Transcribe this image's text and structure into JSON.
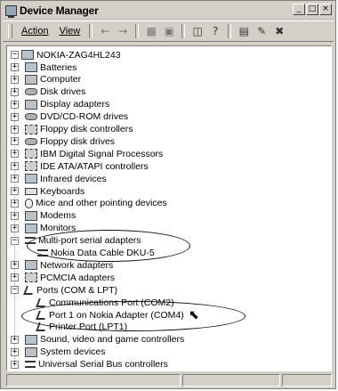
{
  "window": {
    "title": "Device Manager",
    "buttons": {
      "minimize": "_",
      "maximize": "□",
      "close": "×"
    }
  },
  "menubar": {
    "action": "Action",
    "view": "View"
  },
  "toolbar": {
    "back": "←",
    "forward": "→",
    "up": "▦",
    "tree": "▣",
    "properties": "◫",
    "help": "?",
    "scan": "▤",
    "uninstall": "✎",
    "disable": "✖"
  },
  "tree": {
    "root": "NOKIA-ZAG4HL243",
    "nodes": [
      {
        "label": "Batteries",
        "expander": "+",
        "icon": "battery-icon"
      },
      {
        "label": "Computer",
        "expander": "+",
        "icon": "computer-icon"
      },
      {
        "label": "Disk drives",
        "expander": "+",
        "icon": "disk-icon"
      },
      {
        "label": "Display adapters",
        "expander": "+",
        "icon": "display-icon"
      },
      {
        "label": "DVD/CD-ROM drives",
        "expander": "+",
        "icon": "cdrom-icon"
      },
      {
        "label": "Floppy disk controllers",
        "expander": "+",
        "icon": "floppy-controller-icon"
      },
      {
        "label": "Floppy disk drives",
        "expander": "+",
        "icon": "floppy-drive-icon"
      },
      {
        "label": "IBM Digital Signal Processors",
        "expander": "+",
        "icon": "dsp-icon"
      },
      {
        "label": "IDE ATA/ATAPI controllers",
        "expander": "+",
        "icon": "ide-icon"
      },
      {
        "label": "Infrared devices",
        "expander": "+",
        "icon": "infrared-icon"
      },
      {
        "label": "Keyboards",
        "expander": "+",
        "icon": "keyboard-icon"
      },
      {
        "label": "Mice and other pointing devices",
        "expander": "+",
        "icon": "mouse-icon"
      },
      {
        "label": "Modems",
        "expander": "+",
        "icon": "modem-icon"
      },
      {
        "label": "Monitors",
        "expander": "+",
        "icon": "monitor-icon"
      },
      {
        "label": "Multi-port serial adapters",
        "expander": "−",
        "icon": "serial-icon"
      },
      {
        "label": "Nokia Data Cable DKU-5",
        "child": true,
        "icon": "cable-icon"
      },
      {
        "label": "Network adapters",
        "expander": "+",
        "icon": "network-icon"
      },
      {
        "label": "PCMCIA adapters",
        "expander": "+",
        "icon": "pcmcia-icon"
      },
      {
        "label": "Ports (COM & LPT)",
        "expander": "−",
        "icon": "ports-icon"
      },
      {
        "label": "Communications Port (COM2)",
        "child": true,
        "icon": "port-icon"
      },
      {
        "label": "Port 1 on Nokia Adapter (COM4)",
        "child": true,
        "icon": "port-icon",
        "selected": true
      },
      {
        "label": "Printer Port (LPT1)",
        "child": true,
        "icon": "port-icon"
      },
      {
        "label": "Sound, video and game controllers",
        "expander": "+",
        "icon": "sound-icon"
      },
      {
        "label": "System devices",
        "expander": "+",
        "icon": "system-icon"
      },
      {
        "label": "Universal Serial Bus controllers",
        "expander": "+",
        "icon": "usb-icon"
      }
    ]
  }
}
